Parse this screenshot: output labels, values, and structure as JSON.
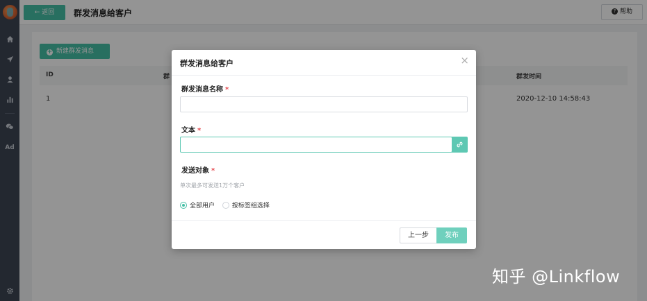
{
  "topbar": {
    "back_label": "← 返回",
    "title": "群发消息给客户",
    "help_label": "帮助",
    "help_icon": "?"
  },
  "sidebar": {
    "items": [
      {
        "icon": "home-icon"
      },
      {
        "icon": "send-icon"
      },
      {
        "icon": "user-icon"
      },
      {
        "icon": "chart-icon"
      },
      {
        "icon": "wechat-icon"
      },
      {
        "icon": "ad-icon",
        "label": "Ad"
      },
      {
        "icon": "gear-icon"
      }
    ]
  },
  "content": {
    "new_button": "新建群发消息",
    "table": {
      "headers": [
        "ID",
        "群",
        "群发时间"
      ],
      "rows": [
        {
          "id": "1",
          "time": "2020-12-10 14:58:43"
        }
      ]
    }
  },
  "modal": {
    "title": "群发消息给客户",
    "close": "×",
    "fields": {
      "name_label": "群发消息名称",
      "text_label": "文本",
      "target_label": "发送对象",
      "required_mark": "*",
      "target_hint": "单次最多可发送1万个客户"
    },
    "radios": [
      {
        "label": "全部用户",
        "selected": true
      },
      {
        "label": "按标签组选择",
        "selected": false
      }
    ],
    "buttons": {
      "prev": "上一步",
      "publish": "发布"
    }
  },
  "watermark": "知乎 @Linkflow",
  "colors": {
    "accent": "#45bfa6",
    "sidebar": "#3d4654",
    "required": "#e5484d"
  }
}
